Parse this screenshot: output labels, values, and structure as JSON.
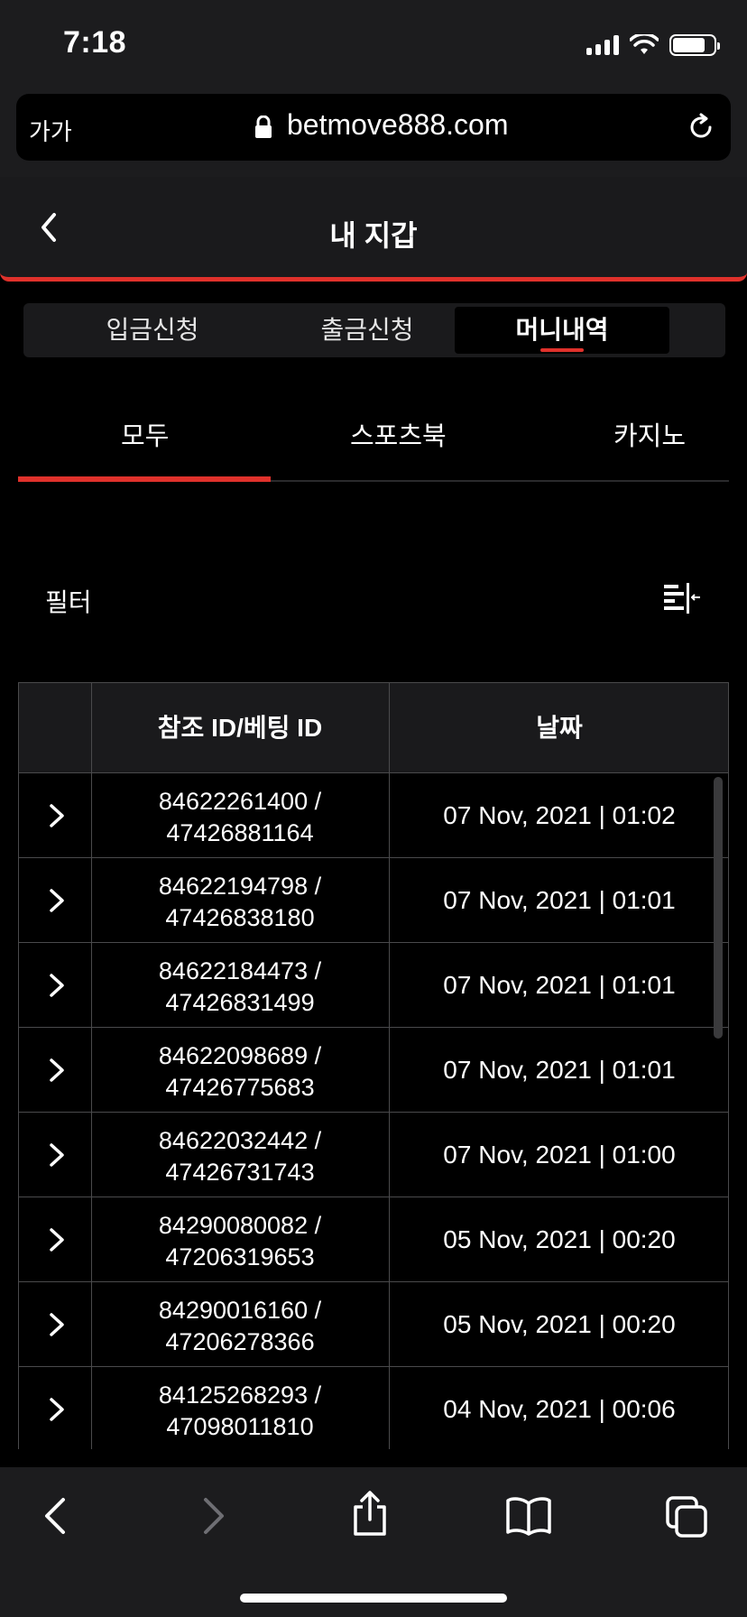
{
  "status_bar": {
    "time": "7:18"
  },
  "browser": {
    "aa_label": "가가",
    "url": "betmove888.com"
  },
  "header": {
    "title": "내 지갑"
  },
  "segments": [
    {
      "label": "입금신청",
      "active": false
    },
    {
      "label": "출금신청",
      "active": false
    },
    {
      "label": "머니내역",
      "active": true
    }
  ],
  "subtabs": [
    {
      "label": "모두",
      "active": true
    },
    {
      "label": "스포츠북",
      "active": false
    },
    {
      "label": "카지노",
      "active": false
    }
  ],
  "filter": {
    "label": "필터"
  },
  "table": {
    "columns": [
      "",
      "참조 ID/베팅 ID",
      "날짜"
    ],
    "rows": [
      {
        "ref": "84622261400 /",
        "bet": "47426881164",
        "date": "07 Nov, 2021 | 01:02"
      },
      {
        "ref": "84622194798 /",
        "bet": "47426838180",
        "date": "07 Nov, 2021 | 01:01"
      },
      {
        "ref": "84622184473 /",
        "bet": "47426831499",
        "date": "07 Nov, 2021 | 01:01"
      },
      {
        "ref": "84622098689 /",
        "bet": "47426775683",
        "date": "07 Nov, 2021 | 01:01"
      },
      {
        "ref": "84622032442 /",
        "bet": "47426731743",
        "date": "07 Nov, 2021 | 01:00"
      },
      {
        "ref": "84290080082 /",
        "bet": "47206319653",
        "date": "05 Nov, 2021 | 00:20"
      },
      {
        "ref": "84290016160 /",
        "bet": "47206278366",
        "date": "05 Nov, 2021 | 00:20"
      },
      {
        "ref": "84125268293 /",
        "bet": "47098011810",
        "date": "04 Nov, 2021 | 00:06"
      }
    ]
  },
  "colors": {
    "accent": "#e0312b",
    "header_bg": "#1a1a1c",
    "background": "#000000"
  }
}
